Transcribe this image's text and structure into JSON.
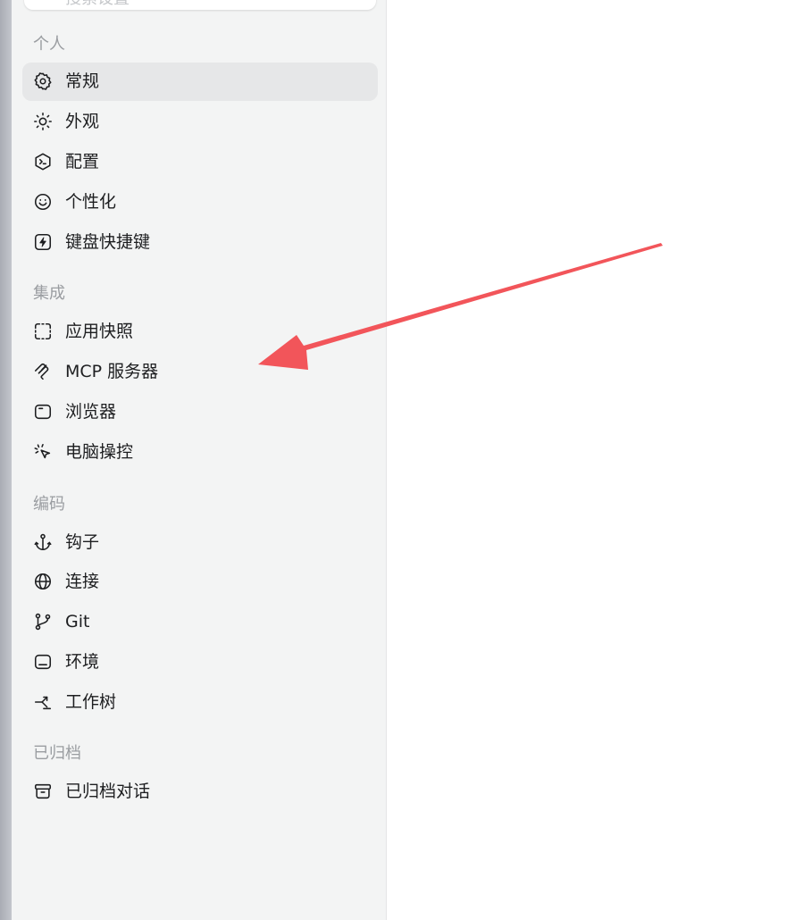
{
  "search": {
    "placeholder_text": "搜索设置"
  },
  "sections": {
    "personal": {
      "title": "个人"
    },
    "integration": {
      "title": "集成"
    },
    "coding": {
      "title": "编码"
    },
    "archived": {
      "title": "已归档"
    }
  },
  "items": {
    "general": {
      "label": "常规",
      "icon": "gear-icon",
      "active": true
    },
    "appearance": {
      "label": "外观",
      "icon": "sun-icon"
    },
    "config": {
      "label": "配置",
      "icon": "terminal-shield-icon"
    },
    "personalize": {
      "label": "个性化",
      "icon": "smile-icon"
    },
    "shortcuts": {
      "label": "键盘快捷键",
      "icon": "lightning-icon"
    },
    "snapshots": {
      "label": "应用快照",
      "icon": "capture-frame-icon"
    },
    "mcp": {
      "label": "MCP 服务器",
      "icon": "mcp-icon"
    },
    "browser": {
      "label": "浏览器",
      "icon": "browser-window-icon"
    },
    "computer_control": {
      "label": "电脑操控",
      "icon": "cursor-click-icon"
    },
    "hooks": {
      "label": "钩子",
      "icon": "anchor-icon"
    },
    "connections": {
      "label": "连接",
      "icon": "globe-icon"
    },
    "git": {
      "label": "Git",
      "icon": "git-branch-icon"
    },
    "environment": {
      "label": "环境",
      "icon": "monitor-icon"
    },
    "worktree": {
      "label": "工作树",
      "icon": "worktree-icon"
    },
    "archived_chats": {
      "label": "已归档对话",
      "icon": "archive-box-icon"
    }
  },
  "annotation": {
    "arrow_color": "#f2555a"
  }
}
